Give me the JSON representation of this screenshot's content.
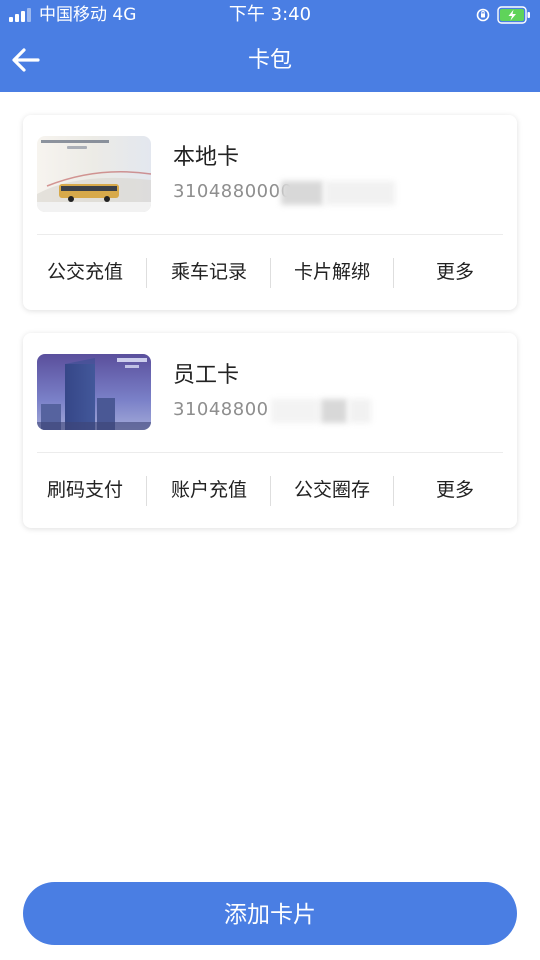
{
  "status_bar": {
    "carrier": "中国移动 4G",
    "time": "下午 3:40"
  },
  "nav": {
    "title": "卡包",
    "back_icon": "arrow-left-icon"
  },
  "cards": [
    {
      "name": "本地卡",
      "number": "3104880000",
      "actions": [
        "公交充值",
        "乘车记录",
        "卡片解绑",
        "更多"
      ]
    },
    {
      "name": "员工卡",
      "number": "31048800",
      "actions": [
        "刷码支付",
        "账户充值",
        "公交圈存",
        "更多"
      ]
    }
  ],
  "footer": {
    "add_button_label": "添加卡片"
  },
  "colors": {
    "primary": "#4a7ee3",
    "text": "#222222",
    "muted": "#8e8e8e"
  }
}
